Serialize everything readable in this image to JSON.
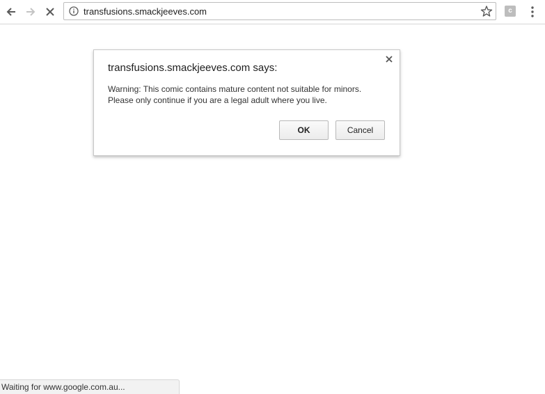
{
  "browser": {
    "url": "transfusions.smackjeeves.com",
    "extension_letter": "c",
    "icons": {
      "back": "arrow-left-icon",
      "forward": "arrow-right-icon",
      "stop": "close-icon",
      "site_info": "info-icon",
      "bookmark": "star-icon",
      "menu": "vertical-dots-icon"
    }
  },
  "dialog": {
    "title": "transfusions.smackjeeves.com says:",
    "message_line1": "Warning: This comic contains mature content not suitable for minors.",
    "message_line2": "Please only continue if you are a legal adult where you live.",
    "ok_label": "OK",
    "cancel_label": "Cancel"
  },
  "status": {
    "text": "Waiting for www.google.com.au..."
  }
}
